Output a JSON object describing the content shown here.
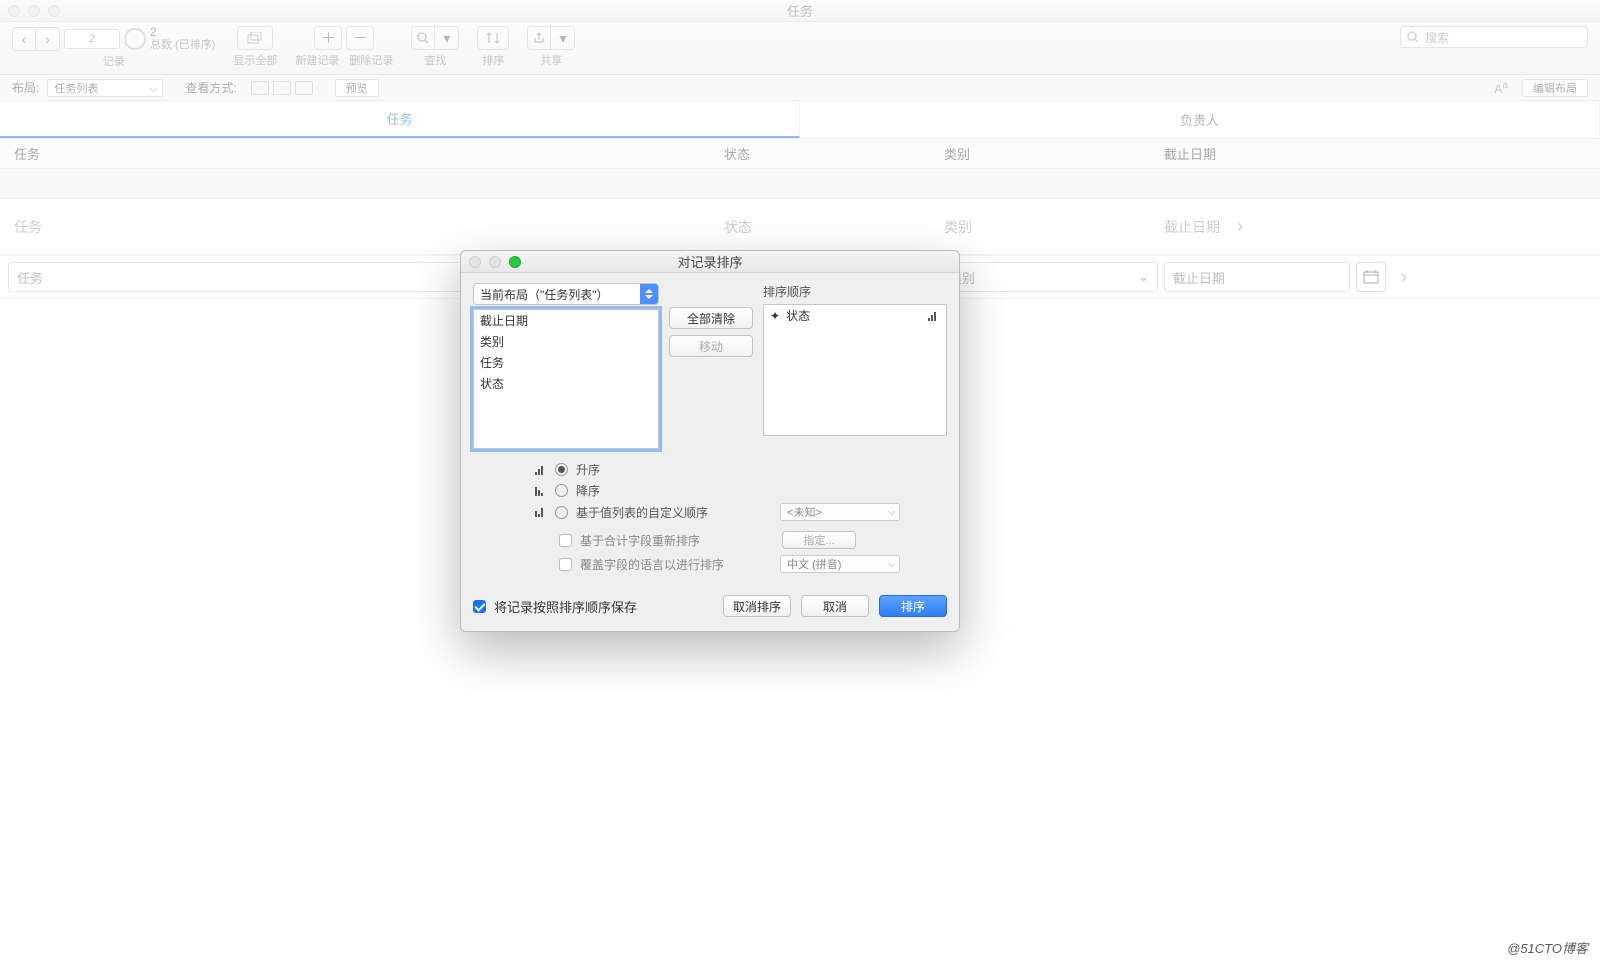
{
  "window": {
    "title": "任务"
  },
  "toolbar": {
    "record_count": "2",
    "record_status": "总数 (已排序)",
    "labels": {
      "records": "记录",
      "show_all": "显示全部",
      "new_record": "新建记录",
      "delete_record": "删除记录",
      "find": "查找",
      "sort": "排序",
      "share": "共享"
    },
    "search_placeholder": "搜索"
  },
  "layoutbar": {
    "layout_label": "布局:",
    "layout_value": "任务列表",
    "view_label": "查看方式:",
    "preview": "预览",
    "edit_layout": "编辑布局"
  },
  "tabs": {
    "tasks": "任务",
    "assignee": "负责人"
  },
  "columns": {
    "task": "任务",
    "status": "状态",
    "category": "类别",
    "due": "截止日期"
  },
  "placeholders": {
    "task": "任务",
    "status": "状态",
    "category": "类别",
    "due": "截止日期"
  },
  "input_row": {
    "task": "任务",
    "category": "类别",
    "due": "截止日期"
  },
  "dialog": {
    "title": "对记录排序",
    "layout_select": "当前布局（\"任务列表\"）",
    "fields": [
      "截止日期",
      "类别",
      "任务",
      "状态"
    ],
    "clear_all": "全部清除",
    "move": "移动",
    "sort_order_label": "排序顺序",
    "sort_items": [
      "状态"
    ],
    "asc": "升序",
    "desc": "降序",
    "custom": "基于值列表的自定义顺序",
    "unknown": "<未知>",
    "reorder_summary": "基于合计字段重新排序",
    "specify": "指定...",
    "override_lang": "覆盖字段的语言以进行排序",
    "lang_value": "中文 (拼音)",
    "save_sorted": "将记录按照排序顺序保存",
    "unsort": "取消排序",
    "cancel": "取消",
    "sort": "排序"
  },
  "watermark": "@51CTO博客"
}
